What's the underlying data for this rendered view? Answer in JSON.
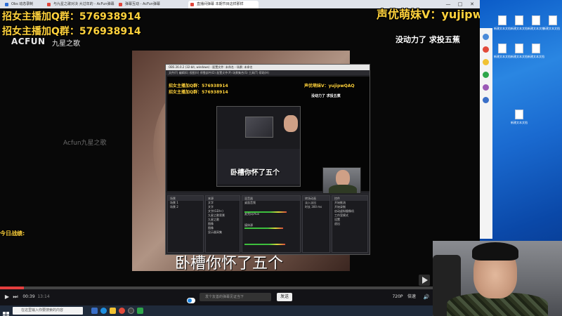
{
  "browser": {
    "tabs": [
      {
        "label": "Obs 动态录制",
        "color": "#2f6fd6"
      },
      {
        "label": "与九星之歌对决 大过年的 - AcFun弹幕",
        "color": "#e0463c"
      },
      {
        "label": "弹幕互动 - AcFun弹幕",
        "color": "#e0463c"
      },
      {
        "label": "直播间弹幕 本期节目这样那样",
        "color": "#e0463c"
      }
    ],
    "window_controls": [
      "—",
      "□",
      "✕"
    ]
  },
  "overlay": {
    "qq_line_1": "招女主播加Q群：576938914",
    "qq_line_2": "招女主播加Q群：576938914",
    "voice_actor": "声优萌妹V：yujipwQAQ",
    "donate_text": "没动力了 求投五蕉",
    "logo_brand": "ACFUN",
    "logo_channel": "九星之歌",
    "watermark": "Acfun九星之歌",
    "today_record": "今日战绩:",
    "subtitle": "卧槽你怀了五个"
  },
  "obs": {
    "title": "OBS 26.0.2 (32-bit, windows) - 配置文件: 未命名 - 场景: 未命名",
    "menu": "文件(F)  编辑(E)  视图(V)  停靠部件(D)  配置文件(P)  场景集合(S)  工具(T)  帮助(H)",
    "inner_qq": "招女主播加Q群：576938914",
    "inner_voice": "声优萌妹V：yujipwQAQ",
    "inner_donate": "没动力了 求投五蕉",
    "inner_subtitle": "卧槽你怀了五个",
    "dock_scenes": {
      "head": "场景",
      "rows": [
        "场景 1",
        "场景 2"
      ]
    },
    "dock_sources": {
      "head": "来源",
      "rows": [
        "文字",
        "文字",
        "文字(GDI+)",
        "九星之歌背景",
        "九星之歌",
        "图像",
        "图像",
        "显示器采集"
      ]
    },
    "dock_mixer": {
      "head": "混音器",
      "rows": [
        "桌面音频",
        "麦克风/Aux",
        "媒体源"
      ]
    },
    "dock_transition": {
      "head": "转场动画",
      "rows": [
        "淡入淡出",
        "时长 300 ms"
      ]
    },
    "dock_controls": {
      "head": "控件",
      "rows": [
        "开始推流",
        "开始录制",
        "启动虚拟摄像机",
        "工作室模式",
        "设置",
        "退出"
      ]
    }
  },
  "player": {
    "time": "00:39",
    "duration": "13:14",
    "progress": 0.05,
    "danmaku_placeholder": "发个友善的弹幕见证当下",
    "send_label": "发送",
    "quality": "720P",
    "speed": "倍速",
    "controls": [
      "▶",
      "⏭",
      "🔊"
    ]
  },
  "taskbar": {
    "search_placeholder": "在这里输入你要搜索的内容",
    "icons": [
      {
        "name": "task-view-icon",
        "color": "#3a6fc8"
      },
      {
        "name": "edge-icon",
        "color": "#1f8fe0"
      },
      {
        "name": "explorer-icon",
        "color": "#f1c232"
      },
      {
        "name": "chrome-icon",
        "color": "#e24a3a"
      },
      {
        "name": "obs-icon",
        "color": "#444444"
      },
      {
        "name": "app-icon",
        "color": "#2ea64a"
      }
    ]
  },
  "desktop": {
    "icons": [
      "新建文本文档",
      "新建文本文档",
      "新建文本文档",
      "新建文本文档",
      "新建文本文档",
      "新建文本文档",
      "新建文本文档",
      "新建文本文档"
    ]
  }
}
